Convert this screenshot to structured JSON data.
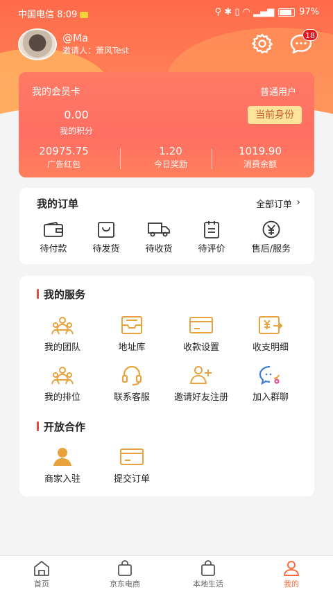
{
  "status_bar": {
    "carrier_time": "中国电信 8:09",
    "battery": "97%"
  },
  "profile": {
    "username": "@Ma",
    "inviter": "邀请人：萧风Test"
  },
  "notification_count": "18",
  "member_card": {
    "title": "我的会员卡",
    "level": "普通用户",
    "points_value": "0.00",
    "points_label": "我的积分",
    "identity_button": "当前身份",
    "stats": [
      {
        "value": "20975.75",
        "label": "广告红包"
      },
      {
        "value": "1.20",
        "label": "今日奖励"
      },
      {
        "value": "1019.90",
        "label": "消费余额"
      }
    ]
  },
  "orders": {
    "title": "我的订单",
    "all_label": "全部订单",
    "items": [
      {
        "label": "待付款",
        "icon": "wallet-icon"
      },
      {
        "label": "待发货",
        "icon": "bag-icon"
      },
      {
        "label": "待收货",
        "icon": "truck-icon"
      },
      {
        "label": "待评价",
        "icon": "clipboard-icon"
      },
      {
        "label": "售后/服务",
        "icon": "yen-icon"
      }
    ]
  },
  "services": {
    "title": "我的服务",
    "items": [
      {
        "label": "我的团队",
        "icon": "team-icon"
      },
      {
        "label": "地址库",
        "icon": "inbox-icon"
      },
      {
        "label": "收款设置",
        "icon": "card-icon"
      },
      {
        "label": "收支明细",
        "icon": "yen-transfer-icon"
      },
      {
        "label": "我的排位",
        "icon": "ranking-icon"
      },
      {
        "label": "联系客服",
        "icon": "headset-icon"
      },
      {
        "label": "邀请好友注册",
        "icon": "add-user-icon"
      },
      {
        "label": "加入群聊",
        "icon": "chat-group-icon"
      }
    ]
  },
  "cooperation": {
    "title": "开放合作",
    "items": [
      {
        "label": "商家入驻",
        "icon": "merchant-icon"
      },
      {
        "label": "提交订单",
        "icon": "card-icon"
      }
    ]
  },
  "tabbar": [
    {
      "label": "首页",
      "icon": "home-icon"
    },
    {
      "label": "京东电商",
      "icon": "shopping-bag-icon"
    },
    {
      "label": "本地生活",
      "icon": "shopping-bag-icon"
    },
    {
      "label": "我的",
      "icon": "user-icon",
      "active": true
    }
  ],
  "colors": {
    "accent": "#ff6a4a",
    "icon_gold": "#e9a23b",
    "active_tab": "#ff6a3c",
    "badge": "#e8141b"
  }
}
